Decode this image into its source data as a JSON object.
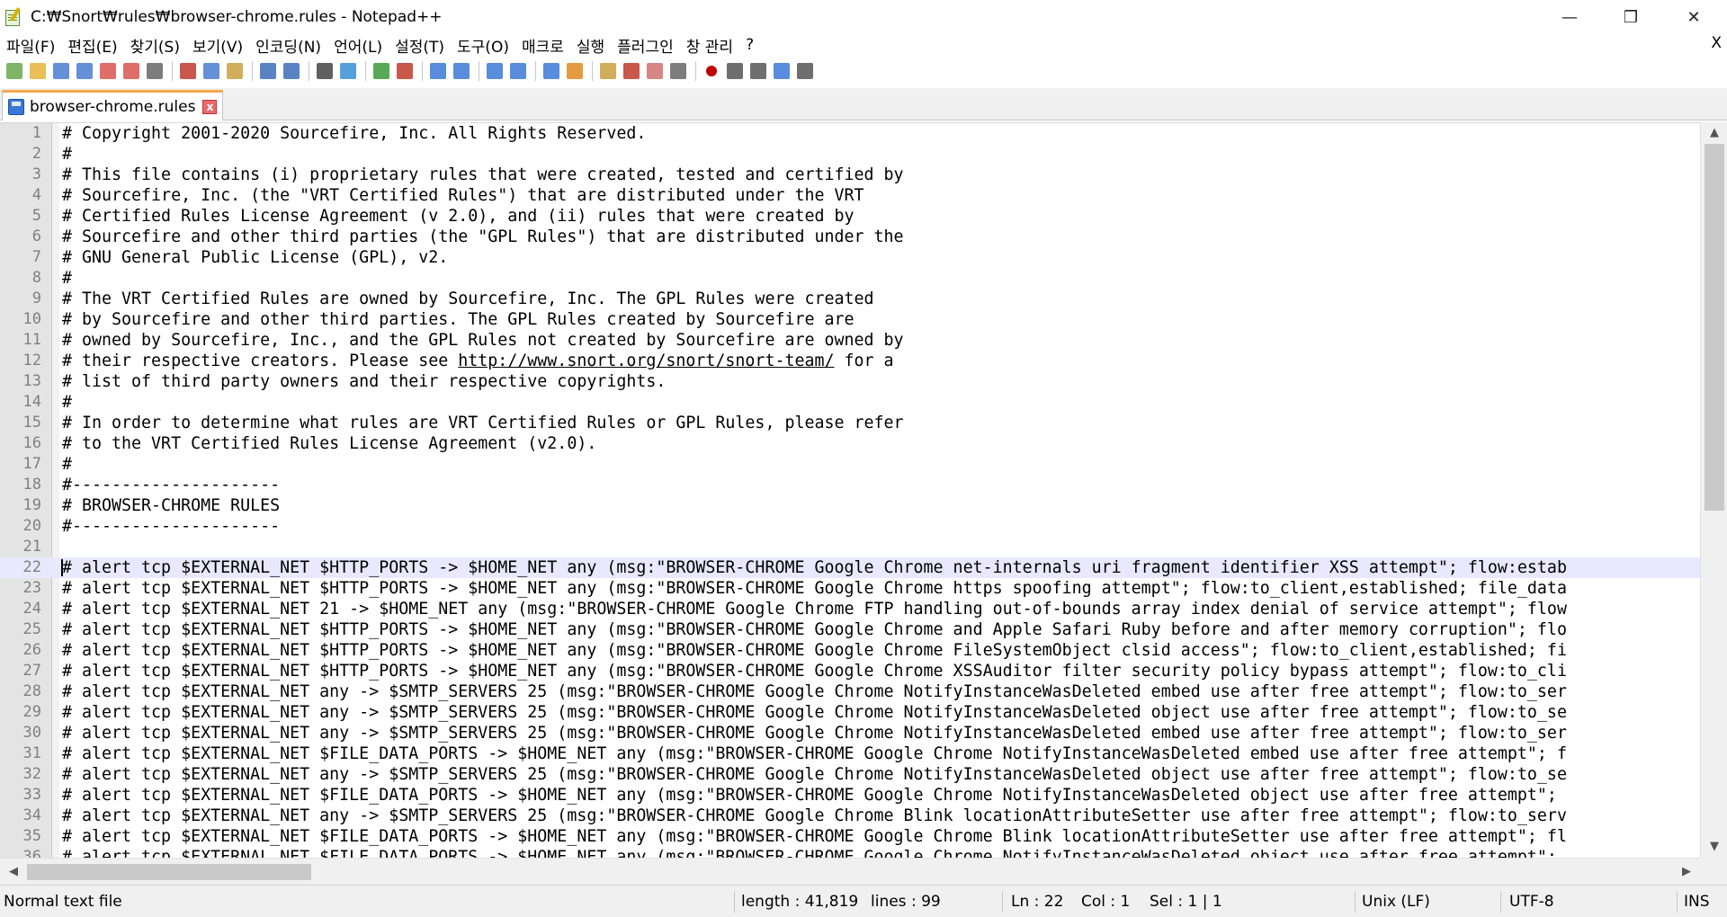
{
  "window": {
    "title": "C:₩Snort₩rules₩browser-chrome.rules - Notepad++",
    "min_label": "—",
    "max_label": "❐",
    "close_label": "✕"
  },
  "menu": {
    "items": [
      "파일(F)",
      "편집(E)",
      "찾기(S)",
      "보기(V)",
      "인코딩(N)",
      "언어(L)",
      "설정(T)",
      "도구(O)",
      "매크로",
      "실행",
      "플러그인",
      "창 관리",
      "?"
    ],
    "close_label": "X"
  },
  "toolbar": {
    "icons": [
      "new-file-icon",
      "open-file-icon",
      "save-icon",
      "save-all-icon",
      "close-icon",
      "close-all-icon",
      "print-icon",
      "cut-icon",
      "copy-icon",
      "paste-icon",
      "undo-icon",
      "redo-icon",
      "find-icon",
      "replace-icon",
      "zoom-in-icon",
      "zoom-out-icon",
      "sync-vertical-icon",
      "sync-horizontal-icon",
      "word-wrap-icon",
      "show-all-chars-icon",
      "indent-guide-icon",
      "document-map-icon",
      "function-list-icon",
      "folder-as-workspace-icon",
      "doc-list-icon",
      "monitoring-icon",
      "record-macro-icon",
      "stop-record-icon",
      "play-macro-icon",
      "run-macro-multiple-icon",
      "save-macro-icon"
    ]
  },
  "tab": {
    "label": "browser-chrome.rules",
    "close_label": "x"
  },
  "editor": {
    "current_line": 22,
    "lines": [
      {
        "n": "1",
        "text": "# Copyright 2001-2020 Sourcefire, Inc. All Rights Reserved."
      },
      {
        "n": "2",
        "text": "#"
      },
      {
        "n": "3",
        "text": "# This file contains (i) proprietary rules that were created, tested and certified by"
      },
      {
        "n": "4",
        "text": "# Sourcefire, Inc. (the \"VRT Certified Rules\") that are distributed under the VRT"
      },
      {
        "n": "5",
        "text": "# Certified Rules License Agreement (v 2.0), and (ii) rules that were created by"
      },
      {
        "n": "6",
        "text": "# Sourcefire and other third parties (the \"GPL Rules\") that are distributed under the"
      },
      {
        "n": "7",
        "text": "# GNU General Public License (GPL), v2."
      },
      {
        "n": "8",
        "text": "#"
      },
      {
        "n": "9",
        "text": "# The VRT Certified Rules are owned by Sourcefire, Inc. The GPL Rules were created"
      },
      {
        "n": "10",
        "text": "# by Sourcefire and other third parties. The GPL Rules created by Sourcefire are"
      },
      {
        "n": "11",
        "text": "# owned by Sourcefire, Inc., and the GPL Rules not created by Sourcefire are owned by"
      },
      {
        "n": "12",
        "pre": "# their respective creators. Please see ",
        "url": "http://www.snort.org/snort/snort-team/",
        "post": " for a"
      },
      {
        "n": "13",
        "text": "# list of third party owners and their respective copyrights."
      },
      {
        "n": "14",
        "text": "#"
      },
      {
        "n": "15",
        "text": "# In order to determine what rules are VRT Certified Rules or GPL Rules, please refer"
      },
      {
        "n": "16",
        "text": "# to the VRT Certified Rules License Agreement (v2.0)."
      },
      {
        "n": "17",
        "text": "#"
      },
      {
        "n": "18",
        "text": "#---------------------"
      },
      {
        "n": "19",
        "text": "# BROWSER-CHROME RULES"
      },
      {
        "n": "20",
        "text": "#---------------------"
      },
      {
        "n": "21",
        "text": ""
      },
      {
        "n": "22",
        "text": "# alert tcp $EXTERNAL_NET $HTTP_PORTS -> $HOME_NET any (msg:\"BROWSER-CHROME Google Chrome net-internals uri fragment identifier XSS attempt\"; flow:estab"
      },
      {
        "n": "23",
        "text": "# alert tcp $EXTERNAL_NET $HTTP_PORTS -> $HOME_NET any (msg:\"BROWSER-CHROME Google Chrome https spoofing attempt\"; flow:to_client,established; file_data"
      },
      {
        "n": "24",
        "text": "# alert tcp $EXTERNAL_NET 21 -> $HOME_NET any (msg:\"BROWSER-CHROME Google Chrome FTP handling out-of-bounds array index denial of service attempt\"; flow"
      },
      {
        "n": "25",
        "text": "# alert tcp $EXTERNAL_NET $HTTP_PORTS -> $HOME_NET any (msg:\"BROWSER-CHROME Google Chrome and Apple Safari Ruby before and after memory corruption\"; flo"
      },
      {
        "n": "26",
        "text": "# alert tcp $EXTERNAL_NET $HTTP_PORTS -> $HOME_NET any (msg:\"BROWSER-CHROME Google Chrome FileSystemObject clsid access\"; flow:to_client,established; fi"
      },
      {
        "n": "27",
        "text": "# alert tcp $EXTERNAL_NET $HTTP_PORTS -> $HOME_NET any (msg:\"BROWSER-CHROME Google Chrome XSSAuditor filter security policy bypass attempt\"; flow:to_cli"
      },
      {
        "n": "28",
        "text": "# alert tcp $EXTERNAL_NET any -> $SMTP_SERVERS 25 (msg:\"BROWSER-CHROME Google Chrome NotifyInstanceWasDeleted embed use after free attempt\"; flow:to_ser"
      },
      {
        "n": "29",
        "text": "# alert tcp $EXTERNAL_NET any -> $SMTP_SERVERS 25 (msg:\"BROWSER-CHROME Google Chrome NotifyInstanceWasDeleted object use after free attempt\"; flow:to_se"
      },
      {
        "n": "30",
        "text": "# alert tcp $EXTERNAL_NET any -> $SMTP_SERVERS 25 (msg:\"BROWSER-CHROME Google Chrome NotifyInstanceWasDeleted embed use after free attempt\"; flow:to_ser"
      },
      {
        "n": "31",
        "text": "# alert tcp $EXTERNAL_NET $FILE_DATA_PORTS -> $HOME_NET any (msg:\"BROWSER-CHROME Google Chrome NotifyInstanceWasDeleted embed use after free attempt\"; f"
      },
      {
        "n": "32",
        "text": "# alert tcp $EXTERNAL_NET any -> $SMTP_SERVERS 25 (msg:\"BROWSER-CHROME Google Chrome NotifyInstanceWasDeleted object use after free attempt\"; flow:to_se"
      },
      {
        "n": "33",
        "text": "# alert tcp $EXTERNAL_NET $FILE_DATA_PORTS -> $HOME_NET any (msg:\"BROWSER-CHROME Google Chrome NotifyInstanceWasDeleted object use after free attempt\";"
      },
      {
        "n": "34",
        "text": "# alert tcp $EXTERNAL_NET any -> $SMTP_SERVERS 25 (msg:\"BROWSER-CHROME Google Chrome Blink locationAttributeSetter use after free attempt\"; flow:to_serv"
      },
      {
        "n": "35",
        "text": "# alert tcp $EXTERNAL_NET $FILE_DATA_PORTS -> $HOME_NET any (msg:\"BROWSER-CHROME Google Chrome Blink locationAttributeSetter use after free attempt\"; fl"
      },
      {
        "n": "36",
        "text": "# alert tcp $EXTERNAL_NET $FILE_DATA_PORTS -> $HOME_NET any (msg:\"BROWSER-CHROME Google Chrome NotifyInstanceWasDeleted object use after free attempt\";"
      }
    ]
  },
  "scrollbars": {
    "up": "▲",
    "down": "▼",
    "left": "◀",
    "right": "▶"
  },
  "status": {
    "file_type": "Normal text file",
    "length": "length : 41,819",
    "lines": "lines : 99",
    "ln": "Ln : 22",
    "col": "Col : 1",
    "sel": "Sel : 1 | 1",
    "eol": "Unix (LF)",
    "encoding": "UTF-8",
    "mode": "INS"
  }
}
